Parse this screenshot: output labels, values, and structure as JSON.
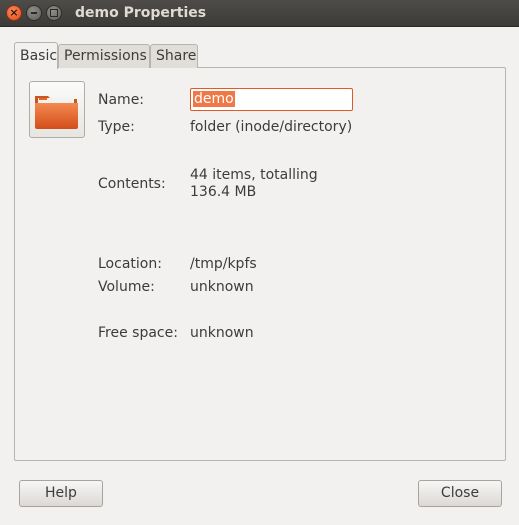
{
  "window": {
    "title": "demo Properties",
    "controls": {
      "close_glyph": "×"
    }
  },
  "tabs": [
    {
      "label": "Basic",
      "active": true
    },
    {
      "label": "Permissions",
      "active": false
    },
    {
      "label": "Share",
      "active": false
    }
  ],
  "basic": {
    "icon": "folder-icon",
    "name_label": "Name:",
    "name_value": "demo",
    "type_label": "Type:",
    "type_value": "folder (inode/directory)",
    "contents_label": "Contents:",
    "contents_value": "44 items, totalling 136.4 MB",
    "location_label": "Location:",
    "location_value": "/tmp/kpfs",
    "volume_label": "Volume:",
    "volume_value": "unknown",
    "free_space_label": "Free space:",
    "free_space_value": "unknown"
  },
  "buttons": {
    "help_label": "Help",
    "close_label": "Close"
  },
  "colors": {
    "accent": "#e05a24",
    "folder": "#e8652a"
  }
}
